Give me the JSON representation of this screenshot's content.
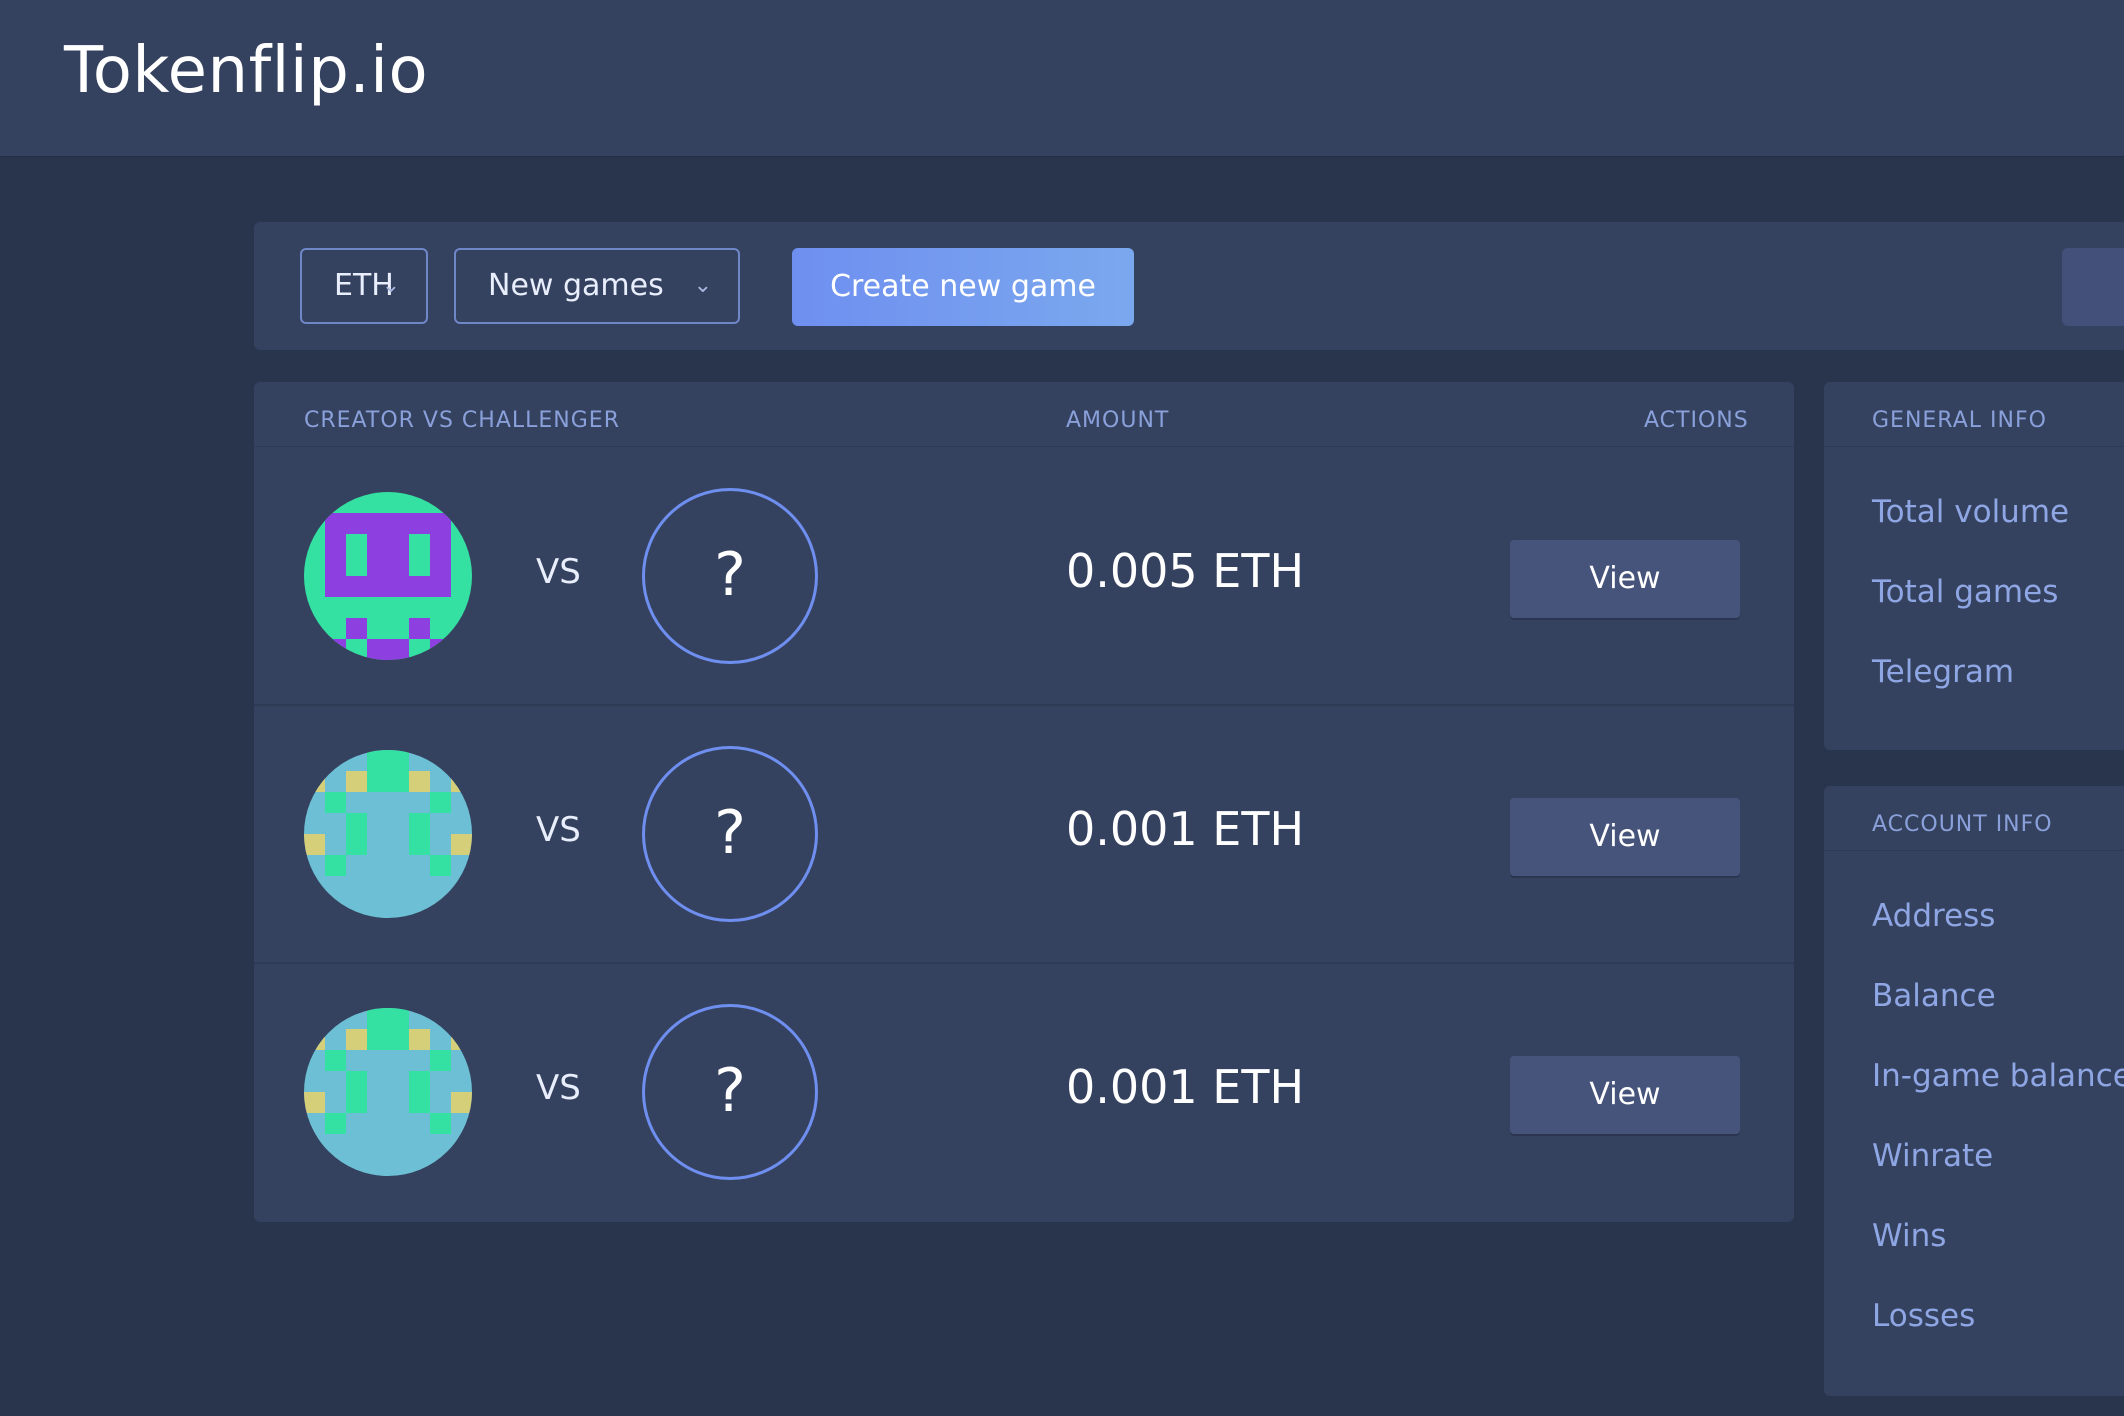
{
  "header": {
    "logo": "Tokenflip.io"
  },
  "toolbar": {
    "currency_select": {
      "value": "ETH"
    },
    "filter_select": {
      "value": "New games"
    },
    "create_button": "Create new game"
  },
  "games_table": {
    "columns": {
      "players": "CREATOR VS CHALLENGER",
      "amount": "AMOUNT",
      "actions": "ACTIONS"
    },
    "rows": [
      {
        "vs": "VS",
        "challenger": "?",
        "amount": "0.005 ETH",
        "action": "View"
      },
      {
        "vs": "VS",
        "challenger": "?",
        "amount": "0.001 ETH",
        "action": "View"
      },
      {
        "vs": "VS",
        "challenger": "?",
        "amount": "0.001 ETH",
        "action": "View"
      }
    ]
  },
  "general_info": {
    "title": "GENERAL INFO",
    "items": [
      "Total volume",
      "Total games",
      "Telegram"
    ]
  },
  "account_info": {
    "title": "ACCOUNT INFO",
    "items": [
      "Address",
      "Balance",
      "In-game balance",
      "Winrate",
      "Wins",
      "Losses"
    ]
  },
  "icons": {
    "select_chevron": "chevron-down-icon",
    "creator_avatar": "identicon-avatar",
    "challenger": "question-mark-icon"
  },
  "colors": {
    "background": "#29344d",
    "panel": "#35425f",
    "accent": "#6f8ff0",
    "muted_text": "#8fa6e4",
    "avatar_purple": "#8e3fe0",
    "avatar_green": "#35e1a2",
    "avatar_teal": "#6cbfd4",
    "avatar_yellow": "#d6cf7a"
  }
}
